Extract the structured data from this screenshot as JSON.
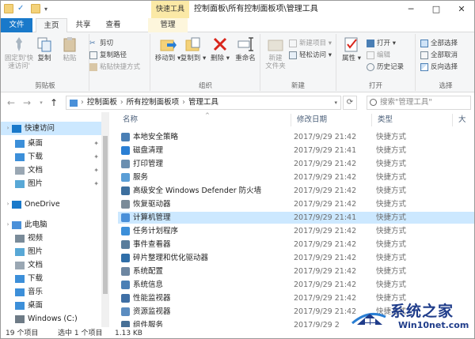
{
  "titlebar": {
    "context_tab_label": "快速工具",
    "title": "控制面板\\所有控制面板项\\管理工具",
    "minimize": "─",
    "maximize": "□",
    "close": "✕"
  },
  "tabs": [
    "文件",
    "主页",
    "共享",
    "查看",
    "管理"
  ],
  "ribbon": {
    "clipboard": {
      "label": "剪贴板",
      "pin": "固定到'快\n速访问'",
      "copy": "复制",
      "paste": "粘贴",
      "cut": "剪切",
      "copy_path": "复制路径",
      "paste_shortcut": "粘贴快捷方式"
    },
    "organize": {
      "label": "组织",
      "move_to": "移动到",
      "copy_to": "复制到",
      "delete": "删除",
      "rename": "重命名"
    },
    "new": {
      "label": "新建",
      "new_folder": "新建\n文件夹",
      "new_item": "新建项目",
      "easy_access": "轻松访问"
    },
    "open": {
      "label": "打开",
      "properties": "属性",
      "open": "打开",
      "edit": "编辑",
      "history": "历史记录"
    },
    "select": {
      "label": "选择",
      "select_all": "全部选择",
      "select_none": "全部取消",
      "invert": "反向选择"
    }
  },
  "address": {
    "segments": [
      "控制面板",
      "所有控制面板项",
      "管理工具"
    ],
    "search_placeholder": "搜索\"管理工具\""
  },
  "nav": {
    "items": [
      {
        "label": "快速访问",
        "level": 0,
        "selected": true,
        "icon": "star-icon",
        "color": "#1979ca"
      },
      {
        "label": "桌面",
        "level": 1,
        "pinned": true,
        "icon": "folder-icon",
        "color": "#3c8fd9"
      },
      {
        "label": "下载",
        "level": 1,
        "pinned": true,
        "icon": "download-icon",
        "color": "#3c8fd9"
      },
      {
        "label": "文档",
        "level": 1,
        "pinned": true,
        "icon": "document-icon",
        "color": "#9aa7b3"
      },
      {
        "label": "图片",
        "level": 1,
        "pinned": true,
        "icon": "picture-icon",
        "color": "#58a8d6"
      },
      {
        "label": "OneDrive",
        "level": 0,
        "icon": "cloud-icon",
        "color": "#1979ca"
      },
      {
        "label": "此电脑",
        "level": 0,
        "icon": "computer-icon",
        "color": "#4a90d9"
      },
      {
        "label": "视频",
        "level": 1,
        "icon": "video-icon",
        "color": "#7a8b99"
      },
      {
        "label": "图片",
        "level": 1,
        "icon": "picture-icon",
        "color": "#58a8d6"
      },
      {
        "label": "文档",
        "level": 1,
        "icon": "document-icon",
        "color": "#9aa7b3"
      },
      {
        "label": "下载",
        "level": 1,
        "icon": "download-icon",
        "color": "#3c8fd9"
      },
      {
        "label": "音乐",
        "level": 1,
        "icon": "music-icon",
        "color": "#3c8fd9"
      },
      {
        "label": "桌面",
        "level": 1,
        "icon": "folder-icon",
        "color": "#3c8fd9"
      },
      {
        "label": "Windows (C:)",
        "level": 1,
        "icon": "drive-icon",
        "color": "#6e7b86"
      }
    ]
  },
  "list": {
    "columns": [
      "名称",
      "修改日期",
      "类型",
      "大"
    ],
    "rows": [
      {
        "name": "本地安全策略",
        "date": "2017/9/29 21:42",
        "type": "快捷方式"
      },
      {
        "name": "磁盘清理",
        "date": "2017/9/29 21:41",
        "type": "快捷方式"
      },
      {
        "name": "打印管理",
        "date": "2017/9/29 21:42",
        "type": "快捷方式"
      },
      {
        "name": "服务",
        "date": "2017/9/29 21:42",
        "type": "快捷方式"
      },
      {
        "name": "高级安全 Windows Defender 防火墙",
        "date": "2017/9/29 21:42",
        "type": "快捷方式"
      },
      {
        "name": "恢复驱动器",
        "date": "2017/9/29 21:42",
        "type": "快捷方式"
      },
      {
        "name": "计算机管理",
        "date": "2017/9/29 21:41",
        "type": "快捷方式",
        "selected": true
      },
      {
        "name": "任务计划程序",
        "date": "2017/9/29 21:42",
        "type": "快捷方式"
      },
      {
        "name": "事件查看器",
        "date": "2017/9/29 21:42",
        "type": "快捷方式"
      },
      {
        "name": "碎片整理和优化驱动器",
        "date": "2017/9/29 21:42",
        "type": "快捷方式"
      },
      {
        "name": "系统配置",
        "date": "2017/9/29 21:42",
        "type": "快捷方式"
      },
      {
        "name": "系统信息",
        "date": "2017/9/29 21:42",
        "type": "快捷方式"
      },
      {
        "name": "性能监视器",
        "date": "2017/9/29 21:42",
        "type": "快捷方式"
      },
      {
        "name": "资源监视器",
        "date": "2017/9/29 21:42",
        "type": "快捷方式"
      },
      {
        "name": "组件服务",
        "date": "2017/9/29 2",
        "type": ""
      }
    ]
  },
  "status": {
    "count": "19 个项目",
    "selected": "选中 1 个项目",
    "size": "1.13 KB"
  },
  "watermark": {
    "title": "系统之家",
    "url": "Win10net.com"
  },
  "colors": {
    "file_tab": "#1979ca",
    "selection": "#cce8ff",
    "context_tab": "#fbe9a6",
    "watermark": "#1f3c8a"
  }
}
